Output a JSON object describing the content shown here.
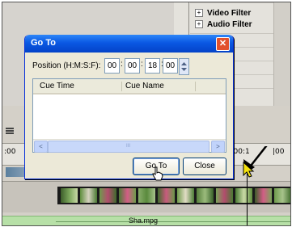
{
  "filter_panel": {
    "items": [
      {
        "label": "Video Filter",
        "expander": "+"
      },
      {
        "label": "Audio Filter",
        "expander": "+"
      }
    ]
  },
  "timeline": {
    "ruler_left_label": ":00",
    "ruler_right_label": "|00:00:1",
    "ruler_far_label": "|00",
    "clip_name": "Sha.mpg"
  },
  "dialog": {
    "title": "Go To",
    "close_glyph": "✕",
    "position_label": "Position (H:M:S:F):",
    "timecode": {
      "hours": "00",
      "minutes": "00",
      "seconds": "18",
      "frames": "00"
    },
    "timecode_separator": ":",
    "list": {
      "columns": [
        "Cue Time",
        "Cue Name"
      ],
      "rows": []
    },
    "scroll_left": "<",
    "scroll_right": ">",
    "scroll_grip": "III",
    "buttons": {
      "goto": "Go To",
      "close": "Close"
    }
  },
  "colors": {
    "titlebar": "#0a58e3",
    "close_button": "#e2512d",
    "audio_track": "#b7e0a7",
    "cursor": "#f5e20f"
  },
  "icons": [
    "plus-expander-icon",
    "close-icon",
    "spinner-icon",
    "scroll-left-icon",
    "scroll-right-icon",
    "hand-cursor-icon",
    "arrow-cursor-icon",
    "list-icon"
  ]
}
